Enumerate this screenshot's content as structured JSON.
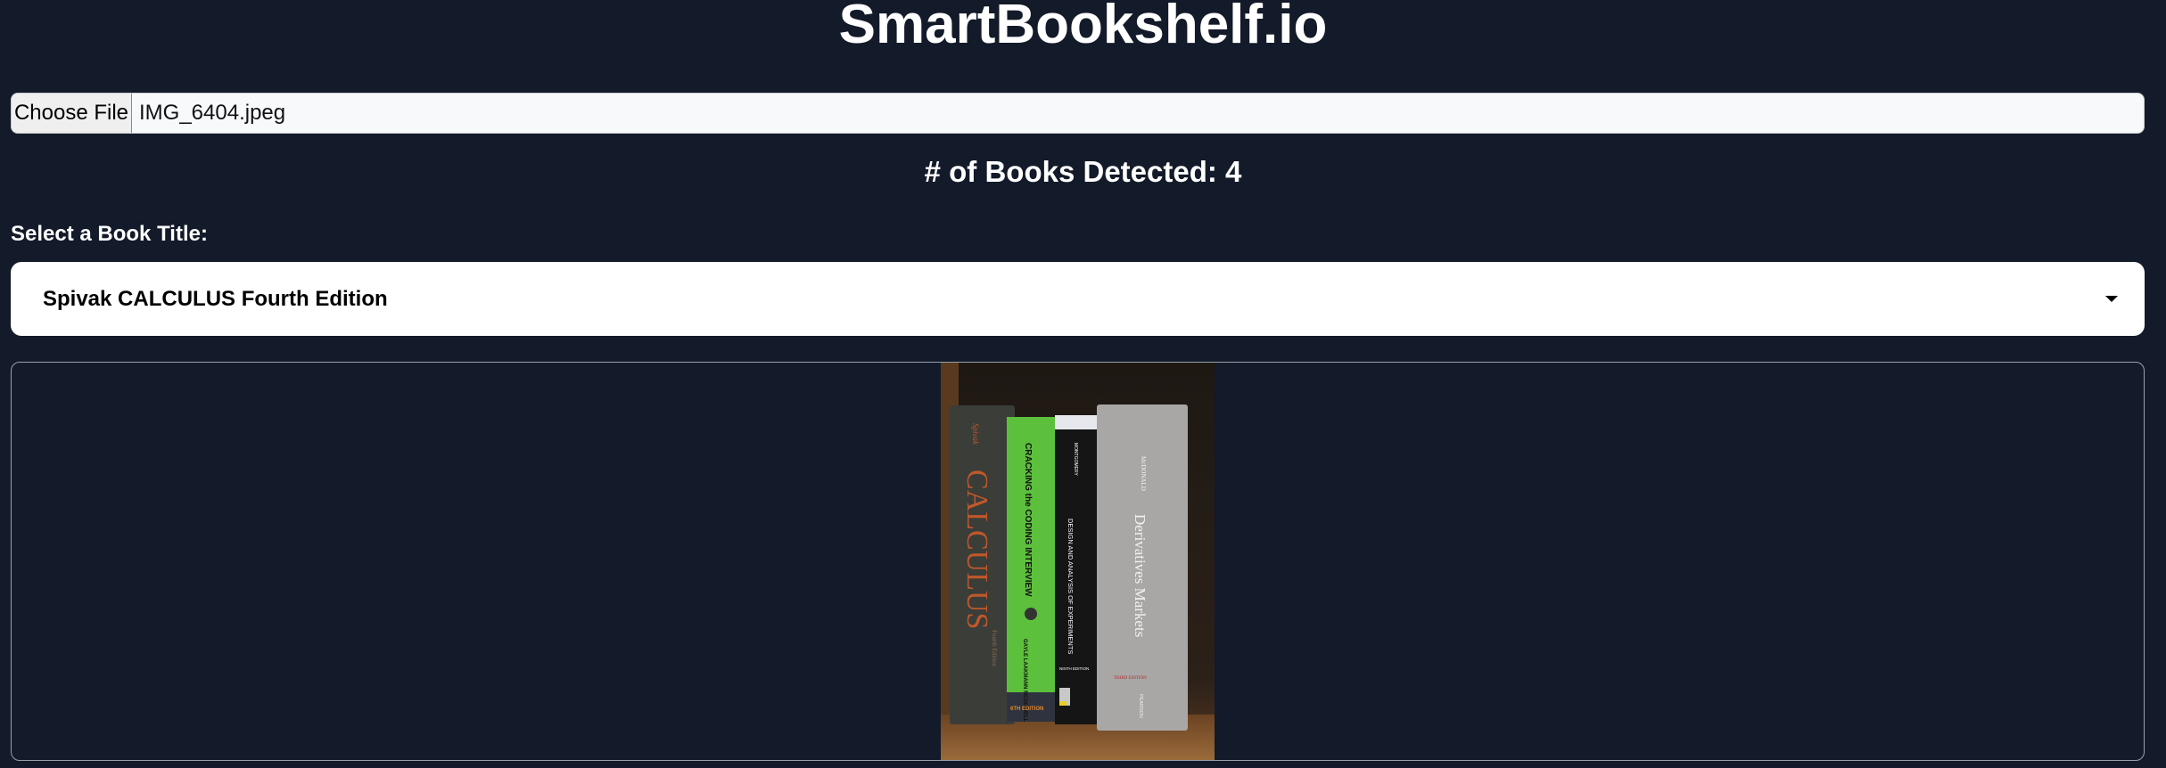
{
  "header": {
    "title": "SmartBookshelf.io"
  },
  "upload": {
    "button_label": "Choose File",
    "file_name": "IMG_6404.jpeg"
  },
  "detection": {
    "count_label": "# of Books Detected: 4"
  },
  "selector": {
    "label": "Select a Book Title:",
    "selected": "Spivak CALCULUS Fourth Edition"
  },
  "photo": {
    "books": [
      {
        "spine_title": "CALCULUS",
        "author": "Spivak",
        "edition": "Fourth Edition",
        "color": "#3b3d39",
        "text_color": "#c0582a"
      },
      {
        "spine_title": "CRACKING the CODING INTERVIEW",
        "author": "GAYLE LAAKMANN MCDOWELL",
        "edition": "6TH EDITION",
        "color": "#5cc03c",
        "text_color": "#111111"
      },
      {
        "spine_title": "DESIGN AND ANALYSIS OF EXPERIMENTS",
        "author": "MONTGOMERY",
        "edition": "NINTH EDITION",
        "color": "#151515",
        "text_color": "#ffffff"
      },
      {
        "spine_title": "Derivatives Markets",
        "author": "McDONALD",
        "edition": "THIRD EDITION",
        "publisher": "PEARSON",
        "color": "#a8a7a6",
        "text_color": "#f2f2f2"
      }
    ]
  }
}
